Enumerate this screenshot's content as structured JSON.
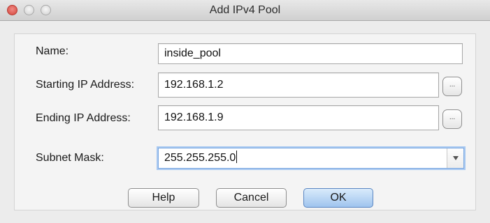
{
  "window": {
    "title": "Add IPv4 Pool"
  },
  "form": {
    "name_label": "Name:",
    "name_value": "inside_pool",
    "start_label": "Starting IP Address:",
    "start_value": "192.168.1.2",
    "end_label": "Ending IP Address:",
    "end_value": "192.168.1.9",
    "mask_label": "Subnet Mask:",
    "mask_value": "255.255.255.0",
    "browse_label": "..."
  },
  "buttons": {
    "help": "Help",
    "cancel": "Cancel",
    "ok": "OK"
  },
  "icons": {
    "close": "close-icon",
    "minimize": "minimize-icon",
    "maximize": "maximize-icon",
    "dropdown": "chevron-down-icon"
  }
}
